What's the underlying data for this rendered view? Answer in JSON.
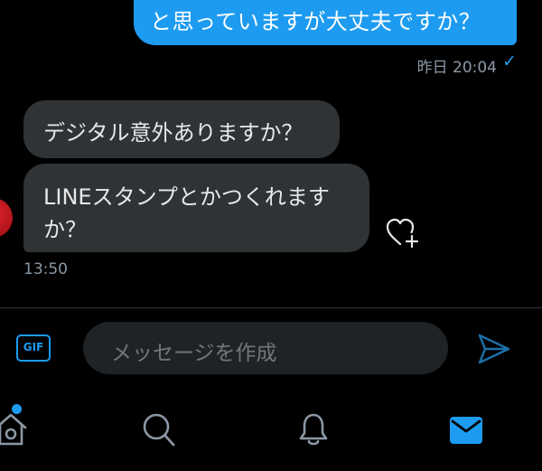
{
  "conversation": {
    "outgoing": {
      "text": "と思っていますが大丈夫ですか？",
      "time": "昨日 20:04",
      "status_icon": "checkmark-icon"
    },
    "incoming": {
      "messages": [
        {
          "lines": [
            "デジタル意外ありますか？"
          ]
        },
        {
          "lines": [
            "LINEスタンプとかつくれます",
            "か？"
          ]
        }
      ],
      "time": "13:50",
      "reaction_icon": "heart-plus-icon"
    }
  },
  "composer": {
    "gif_label": "GIF",
    "placeholder": "メッセージを作成",
    "send_icon": "send-icon"
  },
  "bottom_nav": {
    "items": [
      "home-icon",
      "search-icon",
      "notifications-icon",
      "messages-icon"
    ],
    "active": "messages-icon",
    "home_has_badge": true
  },
  "colors": {
    "accent": "#1d9bf0",
    "background": "#000000",
    "incoming_bubble": "#2f3336",
    "secondary_text": "#8b98a5"
  }
}
